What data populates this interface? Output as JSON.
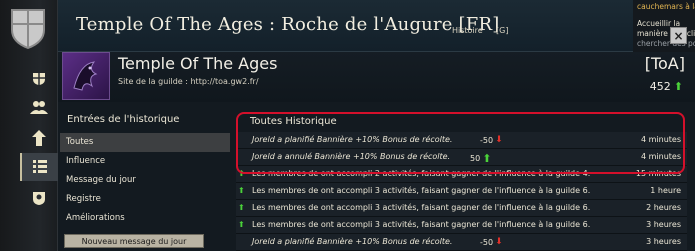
{
  "titlebar": {
    "title": "Temple Of The Ages : Roche de l'Augure [FR]",
    "tab_label": "Histoire",
    "tab_key": "[G]"
  },
  "chat": {
    "lines": [
      {
        "text": "cauchemars à la Po",
        "color": "#e3b552"
      },
      {
        "text": "Accueillir la",
        "color": "#e4e0d0"
      },
      {
        "text": "manière : en cliquant",
        "color": "#e4e0d0"
      },
      {
        "text": "chercher des points",
        "color": "#9aa0a6"
      }
    ],
    "close_label": "×"
  },
  "guild": {
    "name": "Temple Of The Ages",
    "site": "Site de la guilde :  http://toa.gw2.fr/",
    "tag": "[ToA]",
    "influence": "452"
  },
  "nav": {
    "heading": "Entrées de l'historique",
    "items": [
      "Toutes",
      "Influence",
      "Message du jour",
      "Registre",
      "Améliorations"
    ],
    "active_index": 0,
    "new_message_button": "Nouveau message du jour"
  },
  "history": {
    "heading": "Toutes Historique",
    "rows": [
      {
        "msg": "Joreld a planifié Bannière +10% Bonus de récolte.",
        "italic": true,
        "amount": "-50",
        "dir": "down",
        "time": "4 minutes",
        "up_icon": false
      },
      {
        "msg": "Joreld a annulé Bannière +10% Bonus de récolte.",
        "italic": true,
        "amount": "50",
        "dir": "up",
        "time": "4 minutes",
        "up_icon": false
      },
      {
        "msg": "Les membres de  ont accompli 2 activités, faisant gagner de l'influence à la guilde 4.",
        "italic": false,
        "amount": "",
        "dir": "",
        "time": "15 minutes",
        "up_icon": true
      },
      {
        "msg": "Les membres de  ont accompli 3 activités, faisant gagner de l'influence à la guilde 6.",
        "italic": false,
        "amount": "",
        "dir": "",
        "time": "1 heure",
        "up_icon": true
      },
      {
        "msg": "Les membres de  ont accompli 3 activités, faisant gagner de l'influence à la guilde 6.",
        "italic": false,
        "amount": "",
        "dir": "",
        "time": "2 heures",
        "up_icon": true
      },
      {
        "msg": "Les membres de  ont accompli 3 activités, faisant gagner de l'influence à la guilde 6.",
        "italic": false,
        "amount": "",
        "dir": "",
        "time": "3 heures",
        "up_icon": true
      },
      {
        "msg": "Joreld a planifié Bannière +10% Bonus de récolte.",
        "italic": true,
        "amount": "-50",
        "dir": "down",
        "time": "3 heures",
        "up_icon": false
      }
    ]
  },
  "colors": {
    "highlight": "#d4102b",
    "increase": "#4bd23a",
    "decrease": "#e0302a"
  },
  "icons": {
    "rail": [
      "guild-shield-icon",
      "bank-icon",
      "members-icon",
      "ranks-icon",
      "history-icon",
      "upgrades-icon"
    ]
  }
}
